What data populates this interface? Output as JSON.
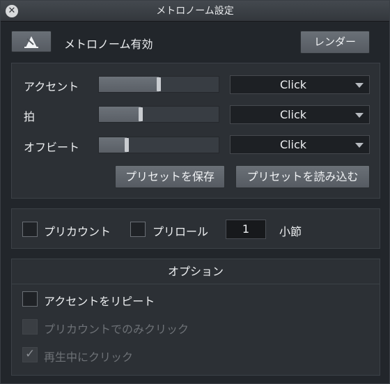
{
  "window": {
    "title": "メトロノーム設定",
    "close_icon": "close-icon"
  },
  "metronome": {
    "enable_label": "メトロノーム有効",
    "render_button": "レンダー",
    "icon": "metronome-icon"
  },
  "tracks": [
    {
      "label": "アクセント",
      "level": 0.5,
      "sound": "Click"
    },
    {
      "label": "拍",
      "level": 0.35,
      "sound": "Click"
    },
    {
      "label": "オフビート",
      "level": 0.23,
      "sound": "Click"
    }
  ],
  "presets": {
    "save_button": "プリセットを保存",
    "load_button": "プリセットを読み込む"
  },
  "count": {
    "precount_label": "プリカウント",
    "precount_checked": false,
    "preroll_label": "プリロール",
    "preroll_checked": false,
    "bars_value": "1",
    "bars_unit": "小節"
  },
  "options": {
    "header": "オプション",
    "items": [
      {
        "label": "アクセントをリピート",
        "checked": false,
        "enabled": true
      },
      {
        "label": "プリカウントでのみクリック",
        "checked": false,
        "enabled": false
      },
      {
        "label": "再生中にクリック",
        "checked": true,
        "enabled": false
      }
    ]
  }
}
